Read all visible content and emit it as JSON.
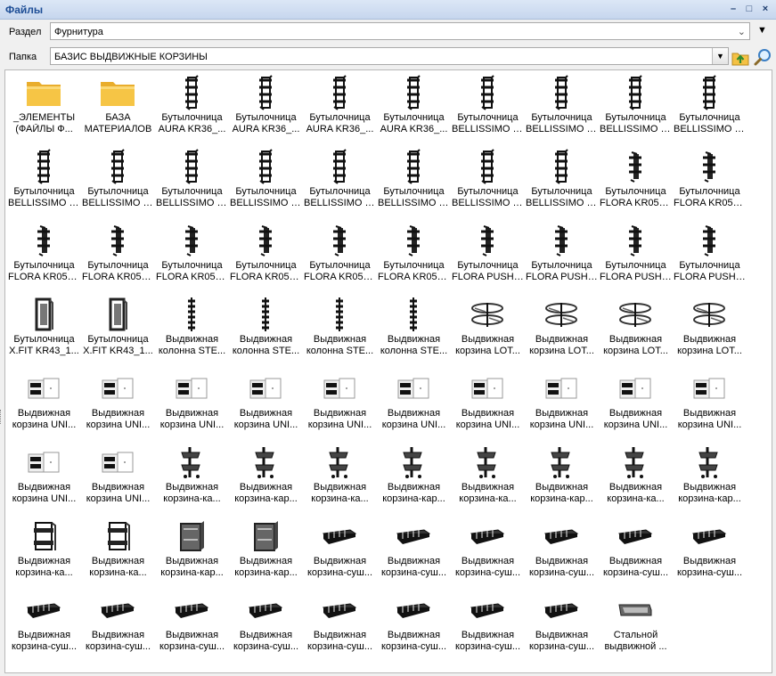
{
  "window": {
    "title": "Файлы",
    "buttons": {
      "minimize": "–",
      "maximize": "□",
      "close": "×"
    }
  },
  "section": {
    "label": "Раздел",
    "value": "Фурнитура"
  },
  "folder": {
    "label": "Папка",
    "value": "БАЗИС ВЫДВИЖНЫЕ КОРЗИНЫ"
  },
  "colors": {
    "title": "#1e4e96",
    "folder": "#f6c545",
    "accent": "#3a8a2a"
  },
  "items": [
    {
      "l1": "_ЭЛЕМЕНТЫ",
      "l2": "(ФАЙЛЫ Ф...",
      "icon": "folder-icon"
    },
    {
      "l1": "БАЗА",
      "l2": "МАТЕРИАЛОВ",
      "icon": "folder-icon"
    },
    {
      "l1": "Бутылочница",
      "l2": "AURA KR36_...",
      "icon": "bottle-rack-icon"
    },
    {
      "l1": "Бутылочница",
      "l2": "AURA KR36_...",
      "icon": "bottle-rack-icon"
    },
    {
      "l1": "Бутылочница",
      "l2": "AURA KR36_...",
      "icon": "bottle-rack-icon"
    },
    {
      "l1": "Бутылочница",
      "l2": "AURA KR36_...",
      "icon": "bottle-rack-icon"
    },
    {
      "l1": "Бутылочница",
      "l2": "BELLISSIMO K...",
      "icon": "bottle-rack-icon"
    },
    {
      "l1": "Бутылочница",
      "l2": "BELLISSIMO K...",
      "icon": "bottle-rack-icon"
    },
    {
      "l1": "Бутылочница",
      "l2": "BELLISSIMO K...",
      "icon": "bottle-rack-icon"
    },
    {
      "l1": "Бутылочница",
      "l2": "BELLISSIMO K...",
      "icon": "bottle-rack-icon"
    },
    {
      "l1": "Бутылочница",
      "l2": "BELLISSIMO K...",
      "icon": "bottle-rack-icon"
    },
    {
      "l1": "Бутылочница",
      "l2": "BELLISSIMO K...",
      "icon": "bottle-rack-icon"
    },
    {
      "l1": "Бутылочница",
      "l2": "BELLISSIMO K...",
      "icon": "bottle-rack-icon"
    },
    {
      "l1": "Бутылочница",
      "l2": "BELLISSIMO K...",
      "icon": "bottle-rack-icon"
    },
    {
      "l1": "Бутылочница",
      "l2": "BELLISSIMO P...",
      "icon": "bottle-rack-icon"
    },
    {
      "l1": "Бутылочница",
      "l2": "BELLISSIMO P...",
      "icon": "bottle-rack-icon"
    },
    {
      "l1": "Бутылочница",
      "l2": "BELLISSIMO P...",
      "icon": "bottle-rack-icon"
    },
    {
      "l1": "Бутылочница",
      "l2": "BELLISSIMO P...",
      "icon": "bottle-rack-icon"
    },
    {
      "l1": "Бутылочница",
      "l2": "FLORA KR05_...",
      "icon": "bottle-rack-small-icon"
    },
    {
      "l1": "Бутылочница",
      "l2": "FLORA KR05_...",
      "icon": "bottle-rack-small-icon"
    },
    {
      "l1": "Бутылочница",
      "l2": "FLORA KR05_...",
      "icon": "bottle-rack-small-icon"
    },
    {
      "l1": "Бутылочница",
      "l2": "FLORA KR05_...",
      "icon": "bottle-rack-small-icon"
    },
    {
      "l1": "Бутылочница",
      "l2": "FLORA KR05_...",
      "icon": "bottle-rack-small-icon"
    },
    {
      "l1": "Бутылочница",
      "l2": "FLORA KR05_...",
      "icon": "bottle-rack-small-icon"
    },
    {
      "l1": "Бутылочница",
      "l2": "FLORA KR05_...",
      "icon": "bottle-rack-small-icon"
    },
    {
      "l1": "Бутылочница",
      "l2": "FLORA KR05_...",
      "icon": "bottle-rack-small-icon"
    },
    {
      "l1": "Бутылочница",
      "l2": "FLORA PUSH ...",
      "icon": "bottle-rack-small-icon"
    },
    {
      "l1": "Бутылочница",
      "l2": "FLORA PUSH ...",
      "icon": "bottle-rack-small-icon"
    },
    {
      "l1": "Бутылочница",
      "l2": "FLORA PUSH ...",
      "icon": "bottle-rack-small-icon"
    },
    {
      "l1": "Бутылочница",
      "l2": "FLORA PUSH ...",
      "icon": "bottle-rack-small-icon"
    },
    {
      "l1": "Бутылочница",
      "l2": "X.FIT KR43_1...",
      "icon": "frame-rack-icon"
    },
    {
      "l1": "Бутылочница",
      "l2": "X.FIT KR43_1...",
      "icon": "frame-rack-icon"
    },
    {
      "l1": "Выдвижная",
      "l2": "колонна STE...",
      "icon": "column-icon"
    },
    {
      "l1": "Выдвижная",
      "l2": "колонна STE...",
      "icon": "column-icon"
    },
    {
      "l1": "Выдвижная",
      "l2": "колонна STE...",
      "icon": "column-icon"
    },
    {
      "l1": "Выдвижная",
      "l2": "колонна STE...",
      "icon": "column-icon"
    },
    {
      "l1": "Выдвижная",
      "l2": "корзина LOT...",
      "icon": "carousel-basket-icon"
    },
    {
      "l1": "Выдвижная",
      "l2": "корзина LOT...",
      "icon": "carousel-basket-icon"
    },
    {
      "l1": "Выдвижная",
      "l2": "корзина LOT...",
      "icon": "carousel-basket-icon"
    },
    {
      "l1": "Выдвижная",
      "l2": "корзина LOT...",
      "icon": "carousel-basket-icon"
    },
    {
      "l1": "Выдвижная",
      "l2": "корзина UNI...",
      "icon": "corner-unit-icon"
    },
    {
      "l1": "Выдвижная",
      "l2": "корзина UNI...",
      "icon": "corner-unit-icon"
    },
    {
      "l1": "Выдвижная",
      "l2": "корзина UNI...",
      "icon": "corner-unit-icon"
    },
    {
      "l1": "Выдвижная",
      "l2": "корзина UNI...",
      "icon": "corner-unit-icon"
    },
    {
      "l1": "Выдвижная",
      "l2": "корзина UNI...",
      "icon": "corner-unit-icon"
    },
    {
      "l1": "Выдвижная",
      "l2": "корзина UNI...",
      "icon": "corner-unit-icon"
    },
    {
      "l1": "Выдвижная",
      "l2": "корзина UNI...",
      "icon": "corner-unit-icon"
    },
    {
      "l1": "Выдвижная",
      "l2": "корзина UNI...",
      "icon": "corner-unit-icon"
    },
    {
      "l1": "Выдвижная",
      "l2": "корзина UNI...",
      "icon": "corner-unit-icon"
    },
    {
      "l1": "Выдвижная",
      "l2": "корзина UNI...",
      "icon": "corner-unit-icon"
    },
    {
      "l1": "Выдвижная",
      "l2": "корзина UNI...",
      "icon": "corner-unit-icon"
    },
    {
      "l1": "Выдвижная",
      "l2": "корзина UNI...",
      "icon": "corner-unit-icon"
    },
    {
      "l1": "Выдвижная",
      "l2": "корзина-ка...",
      "icon": "cargo-basket-icon"
    },
    {
      "l1": "Выдвижная",
      "l2": "корзина-кар...",
      "icon": "cargo-basket-icon"
    },
    {
      "l1": "Выдвижная",
      "l2": "корзина-ка...",
      "icon": "cargo-basket-icon"
    },
    {
      "l1": "Выдвижная",
      "l2": "корзина-кар...",
      "icon": "cargo-basket-icon"
    },
    {
      "l1": "Выдвижная",
      "l2": "корзина-ка...",
      "icon": "cargo-basket-icon"
    },
    {
      "l1": "Выдвижная",
      "l2": "корзина-кар...",
      "icon": "cargo-basket-icon"
    },
    {
      "l1": "Выдвижная",
      "l2": "корзина-ка...",
      "icon": "cargo-basket-icon"
    },
    {
      "l1": "Выдвижная",
      "l2": "корзина-кар...",
      "icon": "cargo-basket-icon"
    },
    {
      "l1": "Выдвижная",
      "l2": "корзина-ка...",
      "icon": "cargo-tall-icon"
    },
    {
      "l1": "Выдвижная",
      "l2": "корзина-ка...",
      "icon": "cargo-tall-icon"
    },
    {
      "l1": "Выдвижная",
      "l2": "корзина-кар...",
      "icon": "cargo-box-icon"
    },
    {
      "l1": "Выдвижная",
      "l2": "корзина-кар...",
      "icon": "cargo-box-icon"
    },
    {
      "l1": "Выдвижная",
      "l2": "корзина-суш...",
      "icon": "dish-drainer-icon"
    },
    {
      "l1": "Выдвижная",
      "l2": "корзина-суш...",
      "icon": "dish-drainer-icon"
    },
    {
      "l1": "Выдвижная",
      "l2": "корзина-суш...",
      "icon": "dish-drainer-icon"
    },
    {
      "l1": "Выдвижная",
      "l2": "корзина-суш...",
      "icon": "dish-drainer-icon"
    },
    {
      "l1": "Выдвижная",
      "l2": "корзина-суш...",
      "icon": "dish-drainer-icon"
    },
    {
      "l1": "Выдвижная",
      "l2": "корзина-суш...",
      "icon": "dish-drainer-icon"
    },
    {
      "l1": "Выдвижная",
      "l2": "корзина-суш...",
      "icon": "dish-drainer-icon"
    },
    {
      "l1": "Выдвижная",
      "l2": "корзина-суш...",
      "icon": "dish-drainer-icon"
    },
    {
      "l1": "Выдвижная",
      "l2": "корзина-суш...",
      "icon": "dish-drainer-icon"
    },
    {
      "l1": "Выдвижная",
      "l2": "корзина-суш...",
      "icon": "dish-drainer-icon"
    },
    {
      "l1": "Выдвижная",
      "l2": "корзина-суш...",
      "icon": "dish-drainer-icon"
    },
    {
      "l1": "Выдвижная",
      "l2": "корзина-суш...",
      "icon": "dish-drainer-icon"
    },
    {
      "l1": "Выдвижная",
      "l2": "корзина-суш...",
      "icon": "dish-drainer-icon"
    },
    {
      "l1": "Выдвижная",
      "l2": "корзина-суш...",
      "icon": "dish-drainer-icon"
    },
    {
      "l1": "Стальной",
      "l2": "выдвижной ...",
      "icon": "steel-tray-icon"
    }
  ]
}
